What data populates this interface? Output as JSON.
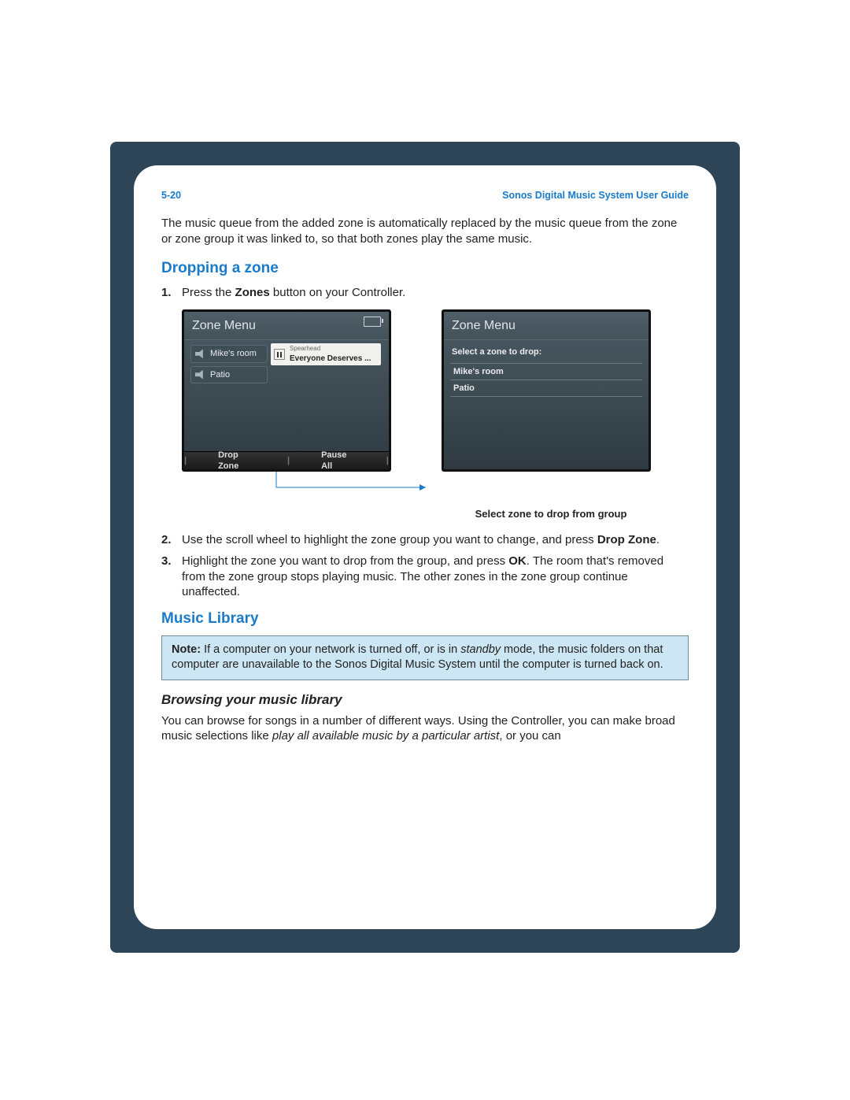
{
  "header": {
    "page_number": "5-20",
    "guide_title": "Sonos Digital Music System User Guide"
  },
  "intro_text": "The music queue from the added zone is automatically replaced by the music queue from the zone or zone group it was linked to, so that both zones play the same music.",
  "section_drop": {
    "heading": "Dropping a zone",
    "step1_pre": "Press the ",
    "step1_bold": "Zones",
    "step1_post": " button on your Controller.",
    "step2_pre": "Use the scroll wheel to highlight the zone group you want to change, and press ",
    "step2_bold": "Drop Zone",
    "step2_post": ".",
    "step3_pre": "Highlight the zone you want to drop from the group, and press ",
    "step3_bold": "OK",
    "step3_post": ". The room that's removed from the zone group stops playing music. The other zones in the zone group continue unaffected."
  },
  "screenshots": {
    "left": {
      "title": "Zone Menu",
      "zone1": "Mike's room",
      "zone2": "Patio",
      "now_playing_artist": "Spearhead",
      "now_playing_track": "Everyone Deserves ...",
      "softkey_left": "Drop Zone",
      "softkey_right": "Pause All"
    },
    "right": {
      "title": "Zone Menu",
      "prompt": "Select a zone to drop:",
      "item1": "Mike's room",
      "item2": "Patio"
    },
    "caption": "Select zone to drop from group"
  },
  "section_library": {
    "heading": "Music Library",
    "note_label": "Note:",
    "note_pre": "  If a computer on your network is turned off, or is in ",
    "note_ital": "standby",
    "note_post": " mode, the music folders on that computer are unavailable to the Sonos Digital Music System until the computer is turned back on.",
    "sub_heading": "Browsing your music library",
    "browse_pre": "You can browse for songs in a number of different ways. Using the Controller, you can make broad music selections like ",
    "browse_ital": "play all available music by a particular artist",
    "browse_post": ", or you can"
  }
}
